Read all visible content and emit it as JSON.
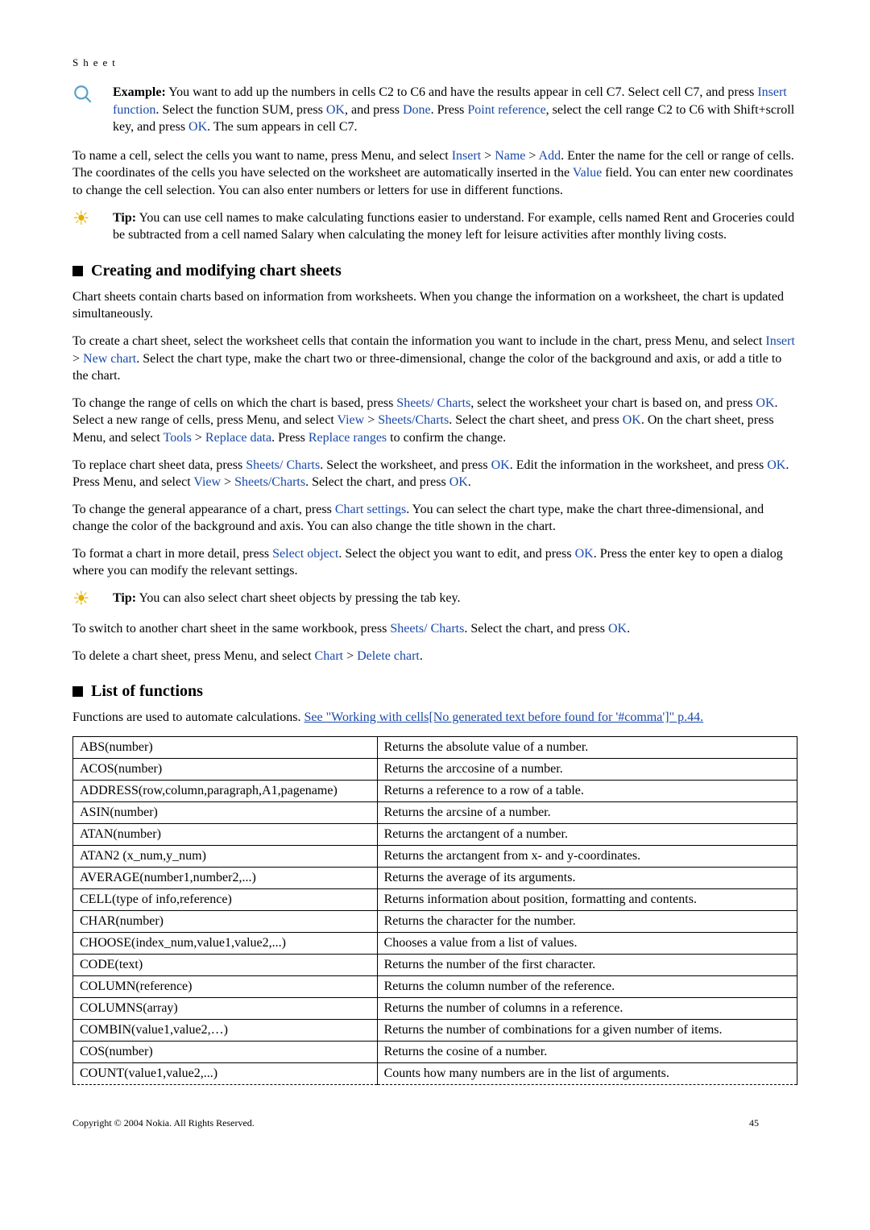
{
  "header": "Sheet",
  "example": {
    "label": "Example:",
    "pre": " You want to add up the numbers in cells C2 to C6 and have the results appear in cell C7. Select cell C7, and press ",
    "k1": "Insert function",
    "mid1": ". Select the function SUM, press ",
    "k2": "OK",
    "mid2": ", and press ",
    "k3": "Done",
    "mid3": ". Press ",
    "k4": "Point reference",
    "mid4": ", select the cell range C2 to C6 with Shift+scroll key, and press ",
    "k5": "OK",
    "tail": ". The sum appears in cell C7."
  },
  "name_para": {
    "p1": "To name a cell, select the cells you want to name, press Menu, and select ",
    "k1": "Insert",
    "sep": " > ",
    "k2": "Name",
    "k3": "Add",
    "p2": ". Enter the name for the cell or range of cells. The coordinates of the cells you have selected on the worksheet are automatically inserted in the ",
    "k4": "Value",
    "p3": " field. You can enter new coordinates to change the cell selection. You can also enter numbers or letters for use in different functions."
  },
  "tip1": {
    "label": "Tip:",
    "text": " You can use cell names to make calculating functions easier to understand. For example, cells named Rent and Groceries could be subtracted from a cell named Salary when calculating the money left for leisure activities after monthly living costs."
  },
  "sec1_title": "Creating and modifying chart sheets",
  "p_chart_intro": "Chart sheets contain charts based on information from worksheets. When you change the information on a worksheet, the chart is updated simultaneously.",
  "p_create": {
    "a": "To create a chart sheet, select the worksheet cells that contain the information you want to include in the chart, press Menu, and select ",
    "k1": "Insert",
    "sep": " > ",
    "k2": "New chart",
    "b": ". Select the chart type, make the chart two or three-dimensional, change the color of the background and axis, or add a title to the chart."
  },
  "p_range": {
    "a": "To change the range of cells on which the chart is based, press ",
    "k1": "Sheets/ Charts",
    "b": ", select the worksheet your chart is based on, and press ",
    "k2": "OK",
    "c": ". Select a new range of cells, press Menu, and select ",
    "k3": "View",
    "sep": " > ",
    "k4": "Sheets/Charts",
    "d": ". Select the chart sheet, and press ",
    "k5": "OK",
    "e": ". On the chart sheet, press Menu, and select ",
    "k6": "Tools",
    "k7": "Replace data",
    "f": ". Press ",
    "k8": "Replace ranges",
    "g": " to confirm the change."
  },
  "p_replace": {
    "a": "To replace chart sheet data, press ",
    "k1": "Sheets/ Charts",
    "b": ". Select the worksheet, and press ",
    "k2": "OK",
    "c": ". Edit the information in the worksheet, and press ",
    "k3": "OK",
    "d": ". Press Menu, and select ",
    "k4": "View",
    "sep": " > ",
    "k5": "Sheets/Charts",
    "e": ". Select the chart, and press ",
    "k6": "OK",
    "f": "."
  },
  "p_general": {
    "a": "To change the general appearance of a chart, press ",
    "k1": "Chart settings",
    "b": ". You can select the chart type, make the chart three-dimensional, and change the color of the background and axis. You can also change the title shown in the chart."
  },
  "p_format": {
    "a": "To format a chart in more detail, press ",
    "k1": "Select object",
    "b": ". Select the object you want to edit, and press ",
    "k2": "OK",
    "c": ". Press the enter key to open a dialog where you can modify the relevant settings."
  },
  "tip2": {
    "label": "Tip:",
    "text": " You can also select chart sheet objects by pressing the tab key."
  },
  "p_switch": {
    "a": "To switch to another chart sheet in the same workbook, press ",
    "k1": "Sheets/ Charts",
    "b": ". Select the chart, and press ",
    "k2": "OK",
    "c": "."
  },
  "p_delete": {
    "a": "To delete a chart sheet, press Menu, and select ",
    "k1": "Chart",
    "sep": " > ",
    "k2": "Delete chart",
    "b": "."
  },
  "sec2_title": "List of functions",
  "func_intro": {
    "a": "Functions are used to automate calculations. ",
    "link": "See \"Working with cells[No generated text before found for '#comma']\" p.44."
  },
  "functions": [
    {
      "sig": "ABS(number)",
      "desc": "Returns the absolute value of a number."
    },
    {
      "sig": "ACOS(number)",
      "desc": "Returns the arccosine of a number."
    },
    {
      "sig": "ADDRESS(row,column,paragraph,A1,pagename)",
      "desc": "Returns a reference to a row of a table."
    },
    {
      "sig": "ASIN(number)",
      "desc": "Returns the arcsine of a number."
    },
    {
      "sig": "ATAN(number)",
      "desc": "Returns the arctangent of a number."
    },
    {
      "sig": "ATAN2 (x_num,y_num)",
      "desc": "Returns the arctangent from x- and y-coordinates."
    },
    {
      "sig": "AVERAGE(number1,number2,...)",
      "desc": "Returns the average of its arguments."
    },
    {
      "sig": "CELL(type of info,reference)",
      "desc": "Returns information about position, formatting and contents."
    },
    {
      "sig": "CHAR(number)",
      "desc": "Returns the character for the number."
    },
    {
      "sig": "CHOOSE(index_num,value1,value2,...)",
      "desc": "Chooses a value from a list of values."
    },
    {
      "sig": "CODE(text)",
      "desc": "Returns the number of the first character."
    },
    {
      "sig": "COLUMN(reference)",
      "desc": "Returns the column number of the reference."
    },
    {
      "sig": "COLUMNS(array)",
      "desc": "Returns the number of columns in a reference."
    },
    {
      "sig": "COMBIN(value1,value2,…)",
      "desc": "Returns the number of combinations for a given number of items."
    },
    {
      "sig": "COS(number)",
      "desc": "Returns the cosine of a number."
    },
    {
      "sig": "COUNT(value1,value2,...)",
      "desc": "Counts how many numbers are in the list of arguments."
    }
  ],
  "footer": {
    "copy": "Copyright © 2004 Nokia. All Rights Reserved.",
    "page": "45"
  }
}
